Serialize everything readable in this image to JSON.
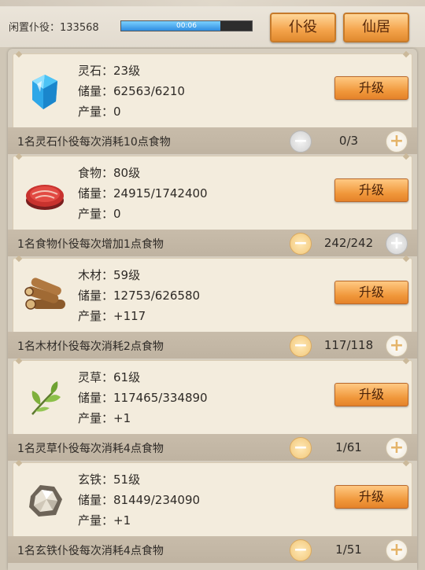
{
  "header": {
    "idle_label": "闲置仆役：",
    "idle_count": "133568",
    "timer_text": "00:06",
    "timer_progress": 0.76,
    "tab_servants": "仆役",
    "tab_residence": "仙居"
  },
  "resources": [
    {
      "icon": "spirit-stone-icon",
      "name_level": "灵石：23级",
      "storage": "储量：62563/6210",
      "output": "产量：0",
      "upgrade": "升级",
      "desc": "1名灵石仆役每次消耗10点食物",
      "count": "0/3",
      "minus_enabled": false,
      "plus_enabled": true
    },
    {
      "icon": "meat-icon",
      "name_level": "食物：80级",
      "storage": "储量：24915/1742400",
      "output": "产量：0",
      "upgrade": "升级",
      "desc": "1名食物仆役每次增加1点食物",
      "count": "242/242",
      "minus_enabled": true,
      "plus_enabled": false
    },
    {
      "icon": "wood-logs-icon",
      "name_level": "木材：59级",
      "storage": "储量：12753/626580",
      "output": "产量：+117",
      "upgrade": "升级",
      "desc": "1名木材仆役每次消耗2点食物",
      "count": "117/118",
      "minus_enabled": true,
      "plus_enabled": true
    },
    {
      "icon": "herb-leaf-icon",
      "name_level": "灵草：61级",
      "storage": "储量：117465/334890",
      "output": "产量：+1",
      "upgrade": "升级",
      "desc": "1名灵草仆役每次消耗4点食物",
      "count": "1/61",
      "minus_enabled": true,
      "plus_enabled": true
    },
    {
      "icon": "iron-ore-icon",
      "name_level": "玄铁：51级",
      "storage": "储量：81449/234090",
      "output": "产量：+1",
      "upgrade": "升级",
      "desc": "1名玄铁仆役每次消耗4点食物",
      "count": "1/51",
      "minus_enabled": true,
      "plus_enabled": true
    }
  ]
}
